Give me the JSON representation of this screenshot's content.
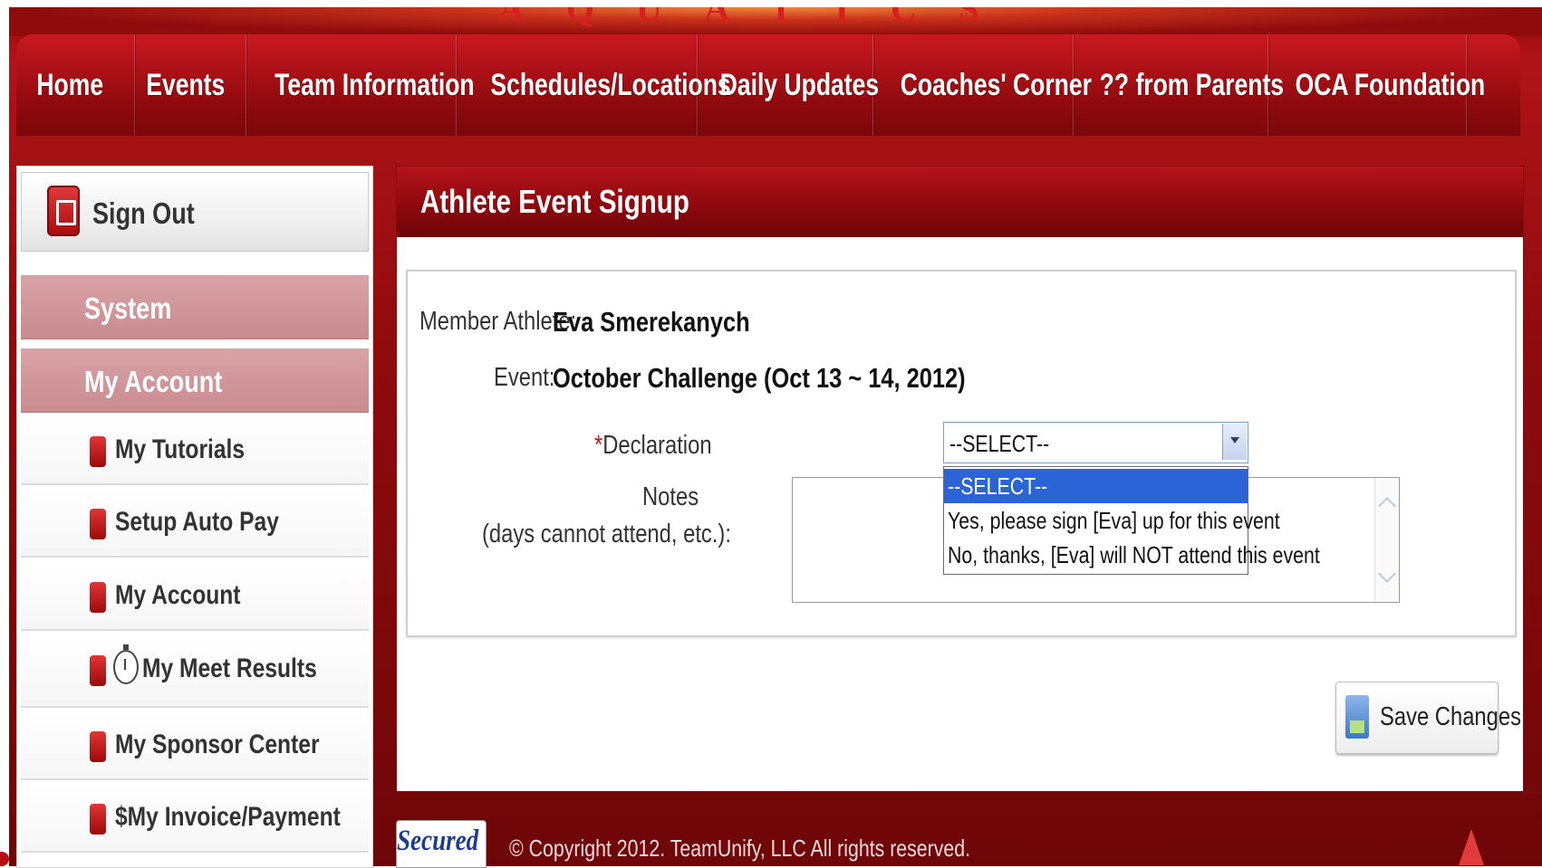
{
  "brand": {
    "logo_text": "AQUATICS"
  },
  "nav": {
    "items": [
      "Home",
      "Events",
      "Team Information",
      "Schedules/Locations",
      "Daily Updates",
      "Coaches' Corner",
      "?? from Parents",
      "OCA Foundation"
    ]
  },
  "sidebar": {
    "sign_out": "Sign Out",
    "section_system": "System",
    "section_my_account": "My Account",
    "items": [
      {
        "label": "My Tutorials"
      },
      {
        "label": "Setup Auto Pay"
      },
      {
        "label": "My Account"
      },
      {
        "label": "My Meet Results"
      },
      {
        "label": "My Sponsor Center"
      },
      {
        "label": "$My Invoice/Payment"
      }
    ]
  },
  "panel": {
    "title": "Athlete Event Signup",
    "member_athlete_label": "Member Athlete:",
    "member_athlete_value": "Eva Smerekanych",
    "event_label": "Event:",
    "event_value": "October Challenge (Oct 13 ~ 14, 2012)",
    "declaration_required": "*",
    "declaration_label": "Declaration",
    "notes_label_line1": "Notes",
    "notes_label_line2": "(days cannot attend, etc.):",
    "notes_value": "",
    "declaration_selected": "--SELECT--",
    "declaration_options": [
      "--SELECT--",
      "Yes, please sign [Eva] up for this event",
      "No, thanks, [Eva] will NOT attend this event"
    ],
    "save_label": "Save Changes"
  },
  "footer": {
    "secured_badge": "Secured",
    "copyright": "© Copyright 2012. TeamUnify, LLC All rights reserved."
  },
  "colors": {
    "brand_red": "#8f0b0e",
    "select_highlight": "#2a64d6"
  }
}
